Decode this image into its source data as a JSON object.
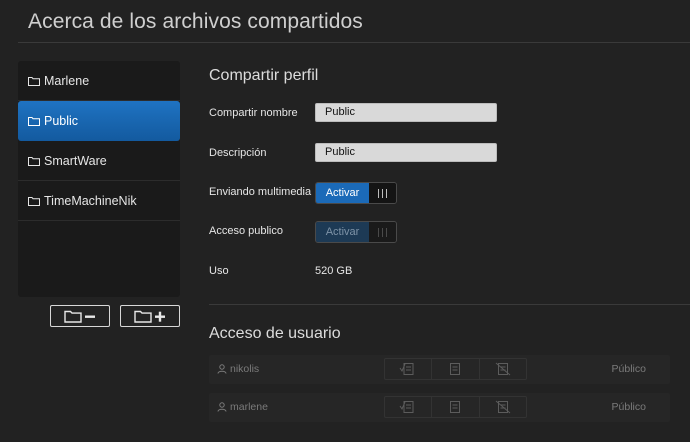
{
  "page": {
    "title": "Acerca de los archivos compartidos"
  },
  "sidebar": {
    "shares": [
      {
        "label": "Marlene"
      },
      {
        "label": "Public"
      },
      {
        "label": "SmartWare"
      },
      {
        "label": "TimeMachineNik"
      }
    ],
    "selected_index": 1
  },
  "profile": {
    "title": "Compartir perfil",
    "name_label": "Compartir nombre",
    "name_value": "Public",
    "description_label": "Descripción",
    "description_value": "Public",
    "media_label": "Enviando multimedia",
    "media_toggle_label": "Activar",
    "public_label": "Acceso publico",
    "public_toggle_label": "Activar",
    "usage_label": "Uso",
    "usage_value": "520 GB"
  },
  "user_access": {
    "title": "Acceso de usuario",
    "users": [
      {
        "name": "nikolis",
        "permission": "Público"
      },
      {
        "name": "marlene",
        "permission": "Público"
      }
    ]
  },
  "colors": {
    "accent": "#1b6ab8",
    "background": "#222222",
    "sidebar_bg": "#1a1a1a"
  }
}
